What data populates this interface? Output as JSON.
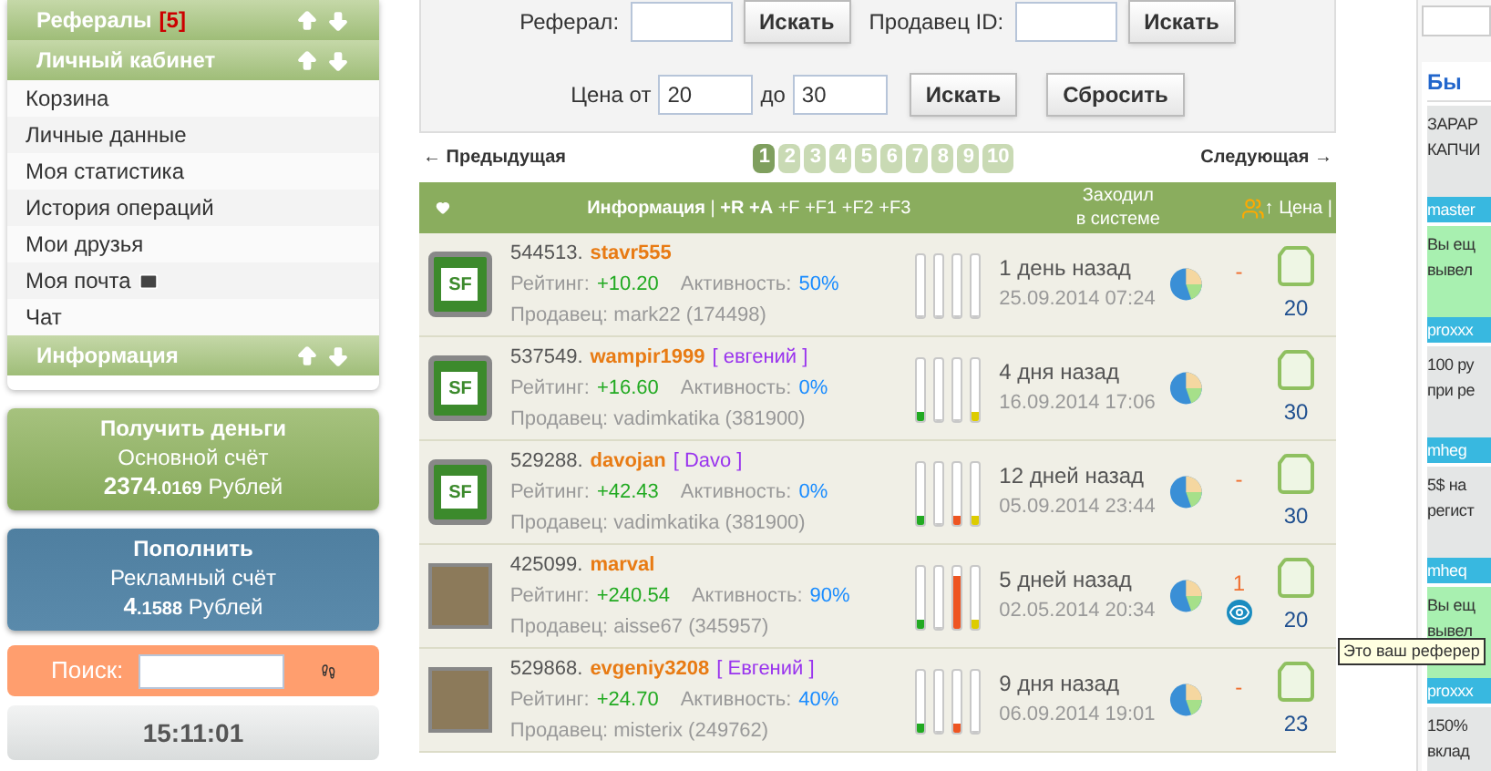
{
  "sidebar": {
    "sections": [
      {
        "title": "Рефералы",
        "count": "[5]"
      },
      {
        "title": "Личный кабинет",
        "items": [
          {
            "label": "Корзина",
            "mail": false
          },
          {
            "label": "Личные данные",
            "mail": false
          },
          {
            "label": "Моя статистика",
            "mail": false
          },
          {
            "label": "История операций",
            "mail": false
          },
          {
            "label": "Мои друзья",
            "mail": false
          },
          {
            "label": "Моя почта",
            "mail": true
          },
          {
            "label": "Чат",
            "mail": false
          }
        ]
      },
      {
        "title": "Информация"
      }
    ],
    "cards": [
      {
        "kind": "withdraw",
        "title": "Получить деньги",
        "subtitle": "Основной счёт",
        "amount_int": "2374",
        "amount_frac": ".0169",
        "currency": "Рублей"
      },
      {
        "kind": "deposit",
        "title": "Пополнить",
        "subtitle": "Рекламный счёт",
        "amount_int": "4",
        "amount_frac": ".1588",
        "currency": "Рублей"
      }
    ],
    "search": {
      "label": "Поиск:"
    },
    "clock": "15:11:01"
  },
  "filters": {
    "referral_label": "Реферал:",
    "seller_label": "Продавец ID:",
    "referral_search_button": "Искать",
    "seller_search_button": "Искать",
    "price_search_button": "Искать",
    "price_from_label": "Цена от",
    "price_from": "20",
    "price_to_label": "до",
    "price_to": "30",
    "reset_button": "Сбросить"
  },
  "pagination": {
    "prev": "← Предыдущая",
    "next": "Следующая →",
    "pages": [
      {
        "label": "1",
        "selected": true
      },
      {
        "label": "2",
        "selected": false
      },
      {
        "label": "3",
        "selected": false
      },
      {
        "label": "4",
        "selected": false
      },
      {
        "label": "5",
        "selected": false
      },
      {
        "label": "6",
        "selected": false
      },
      {
        "label": "7",
        "selected": false
      },
      {
        "label": "8",
        "selected": false
      },
      {
        "label": "9",
        "selected": false
      },
      {
        "label": "10",
        "selected": false
      }
    ]
  },
  "table": {
    "columns": {
      "info": "**Информация** | **+R** **+A** +F +F1 +F2 +F3",
      "last_seen_1": "Заходил",
      "last_seen_2": "в системе",
      "price": "↑ Цена |"
    },
    "rows": [
      {
        "avatar_logo": "SF",
        "id": "544513.",
        "name": "stavr555",
        "rating_label": "Рейтинг:",
        "rating": "+10.20",
        "activity_label": "Активность:",
        "activity": "50%",
        "seller": "Продавец: mark22 (174498)",
        "bars": [
          {
            "level": 0
          },
          {
            "level": 0
          },
          {
            "level": 0
          },
          {
            "level": 0
          }
        ],
        "ago": "1 день назад",
        "date": "25.09.2014 07:24",
        "refs": "-",
        "eye": false,
        "price": "20"
      },
      {
        "avatar_logo": "SF",
        "id": "537549.",
        "name": "wampir1999",
        "alias": "[ евгений ]",
        "rating_label": "Рейтинг:",
        "rating": "+16.60",
        "activity_label": "Активность:",
        "activity": "0%",
        "seller": "Продавец: vadimkatika (381900)",
        "bars": [
          {
            "level": 0.15,
            "color": "#22aa22"
          },
          {
            "level": 0
          },
          {
            "level": 0
          },
          {
            "level": 0.15,
            "color": "#ddcc00"
          }
        ],
        "ago": "4 дня назад",
        "date": "16.09.2014 17:06",
        "eye": false,
        "price": "30"
      },
      {
        "avatar_logo": "SF",
        "id": "529288.",
        "name": "davojan",
        "alias": "[ Davo ]",
        "rating_label": "Рейтинг:",
        "rating": "+42.43",
        "activity_label": "Активность:",
        "activity": "0%",
        "seller": "Продавец: vadimkatika (381900)",
        "bars": [
          {
            "level": 0.15,
            "color": "#22aa22"
          },
          {
            "level": 0
          },
          {
            "level": 0.15,
            "color": "#ee5522"
          },
          {
            "level": 0.15,
            "color": "#ddcc00"
          }
        ],
        "ago": "12 дней назад",
        "date": "05.09.2014 23:44",
        "refs": "-",
        "eye": false,
        "price": "30"
      },
      {
        "id": "425099.",
        "name": "marval",
        "rating_label": "Рейтинг:",
        "rating": "+240.54",
        "activity_label": "Активность:",
        "activity": "90%",
        "seller": "Продавец: aisse67 (345957)",
        "bars": [
          {
            "level": 0.15,
            "color": "#22aa22"
          },
          {
            "level": 0
          },
          {
            "level": 0.85,
            "color": "#ee5522"
          },
          {
            "level": 0.15,
            "color": "#ddcc00"
          }
        ],
        "ago": "5 дней назад",
        "date": "02.05.2014 20:34",
        "refs": "1",
        "eye": true,
        "price": "20"
      },
      {
        "id": "529868.",
        "name": "evgeniy3208",
        "alias": "[ Евгений ]",
        "rating_label": "Рейтинг:",
        "rating": "+24.70",
        "activity_label": "Активность:",
        "activity": "40%",
        "seller": "Продавец: misterix (249762)",
        "bars": [
          {
            "level": 0.15,
            "color": "#22aa22"
          },
          {
            "level": 0
          },
          {
            "level": 0.15,
            "color": "#ee5522"
          },
          {
            "level": 0
          }
        ],
        "ago": "9 дня назад",
        "date": "06.09.2014 19:01",
        "refs": "-",
        "eye": false,
        "price": "23"
      }
    ]
  },
  "tooltip": "Это ваш реферер",
  "right_panel": {
    "heading": "Бы",
    "ads": [
      {
        "lines": [
          "ЗАРАР",
          "КАПЧИ"
        ],
        "author": "master",
        "highlighted": false
      },
      {
        "lines": [
          "Вы ещ",
          "вывел"
        ],
        "author": "proxxx",
        "highlighted": true
      },
      {
        "lines": [
          "100 ру",
          "при ре"
        ],
        "author": "mheg",
        "highlighted": false
      },
      {
        "lines": [
          "5$ на",
          "регист"
        ],
        "author": "mheq",
        "highlighted": false
      },
      {
        "lines": [
          "Вы ещ",
          "вывел"
        ],
        "author": "proxxx",
        "highlighted": true
      },
      {
        "lines": [
          "150%",
          "вклад"
        ],
        "highlighted": false
      }
    ]
  }
}
